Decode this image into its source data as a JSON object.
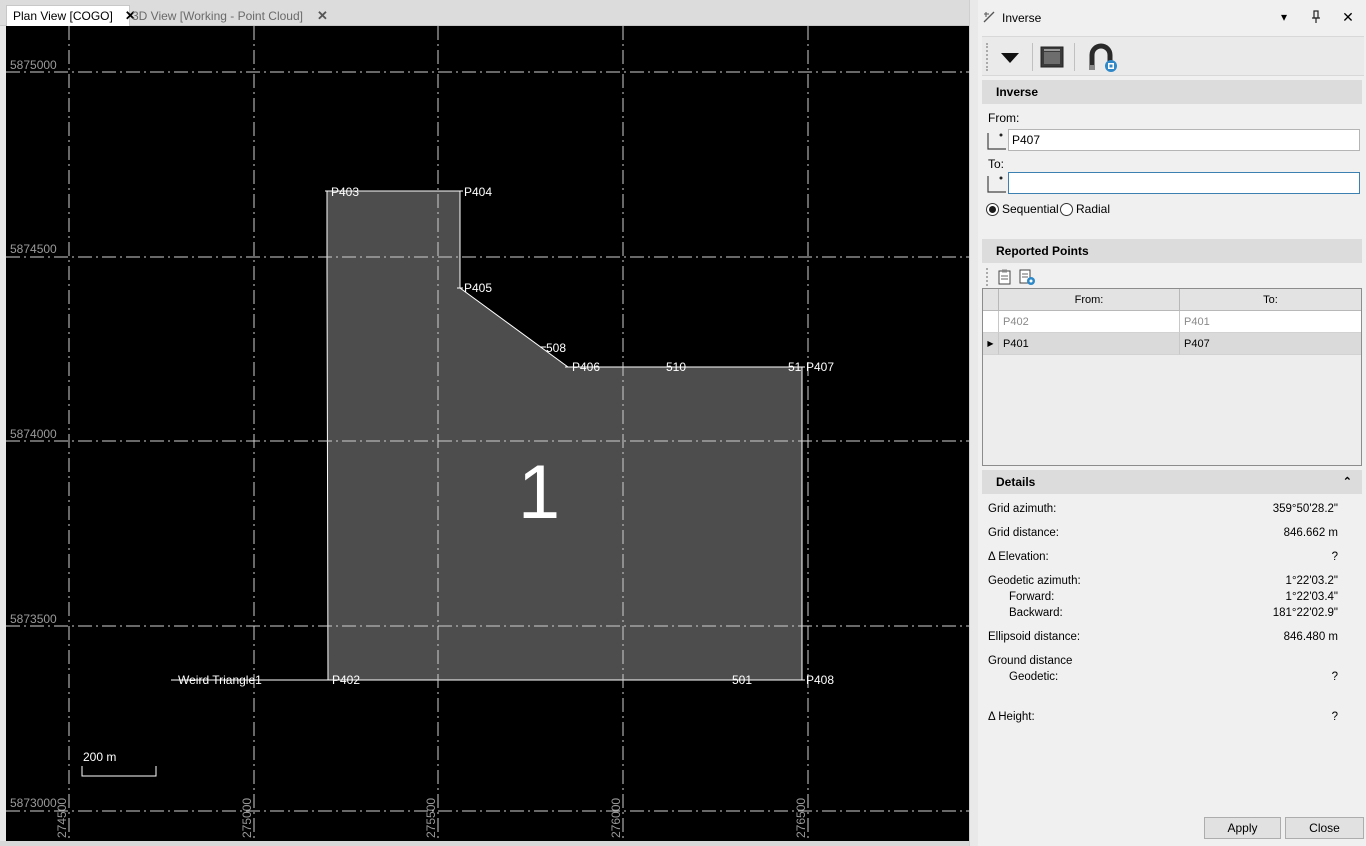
{
  "tabs": [
    {
      "label": "Plan View [COGO]",
      "active": true,
      "close": "✕"
    },
    {
      "label": "3D View [Working - Point Cloud]",
      "active": false,
      "close": "✕"
    }
  ],
  "plan": {
    "y_labels": [
      "5875000",
      "5874500",
      "5874000",
      "5873500",
      "5873000"
    ],
    "x_labels": [
      "274500",
      "275000",
      "275500",
      "276000",
      "276500"
    ],
    "parcel_label": "1",
    "point_labels": {
      "p403": "P403",
      "p404": "P404",
      "p405": "P405",
      "p508": "508",
      "p406": "P406",
      "p510": "510",
      "p51": "51",
      "p407": "P407",
      "p402": "P402",
      "weird": "Weird Triangle1",
      "p501": "501",
      "p408": "P408"
    },
    "scale_bar": "200 m"
  },
  "panel": {
    "title": "Inverse",
    "dropdown": "▾",
    "pin": "📌",
    "close": "✕",
    "inverse_section": "Inverse",
    "from_label": "From:",
    "from_value": "P407",
    "to_label": "To:",
    "to_value": "",
    "sequential_label": "Sequential",
    "radial_label": "Radial",
    "reported_section": "Reported Points",
    "grid": {
      "col_from": "From:",
      "col_to": "To:",
      "rows": [
        {
          "from": "P402",
          "to": "P401"
        },
        {
          "from": "P401",
          "to": "P407"
        }
      ]
    },
    "details_section": "Details",
    "details_collapse": "⌃",
    "details": {
      "grid_azimuth_label": "Grid azimuth:",
      "grid_azimuth_value": "359°50'28.2\"",
      "grid_distance_label": "Grid distance:",
      "grid_distance_value": "846.662 m",
      "delta_elevation_label": "Δ Elevation:",
      "delta_elevation_value": "?",
      "geodetic_azimuth_label": "Geodetic azimuth:",
      "geodetic_azimuth_value": "1°22'03.2\"",
      "forward_label": "Forward:",
      "forward_value": "1°22'03.4\"",
      "backward_label": "Backward:",
      "backward_value": "181°22'02.9\"",
      "ellipsoid_distance_label": "Ellipsoid distance:",
      "ellipsoid_distance_value": "846.480 m",
      "ground_distance_label": "Ground distance",
      "geodetic_label": "Geodetic:",
      "geodetic_value": "?",
      "delta_height_label": "Δ Height:",
      "delta_height_value": "?"
    },
    "apply_label": "Apply",
    "close_label": "Close"
  },
  "colors": {
    "canvas_bg": "#000000",
    "parcel_fill": "#4d4d4d",
    "grid_line": "#cfcfcf",
    "axis_label": "#9a9a9a",
    "point_label": "#ffffff",
    "input_focus": "#3c7fb1"
  },
  "icons": [
    "dropdown-arrow-icon",
    "command-window-icon",
    "snap-magnet-icon",
    "point-pick-icon",
    "copy-report-icon",
    "report-settings-icon",
    "inverse-tool-icon",
    "pin-icon",
    "close-icon"
  ]
}
